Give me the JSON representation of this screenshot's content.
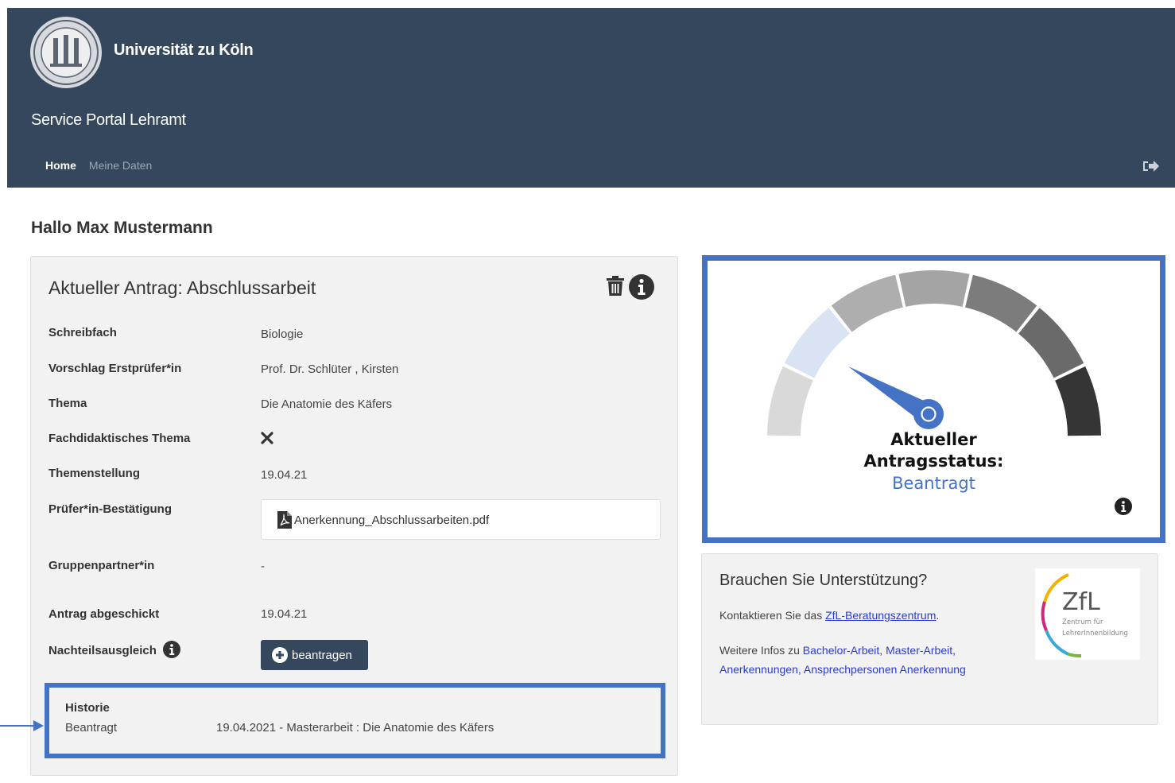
{
  "header": {
    "university": "Universität zu Köln",
    "portal": "Service Portal Lehramt",
    "nav": [
      {
        "label": "Home",
        "active": true
      },
      {
        "label": "Meine Daten",
        "active": false
      }
    ]
  },
  "greeting": "Hallo Max Mustermann",
  "application": {
    "title": "Aktueller Antrag: Abschlussarbeit",
    "rows": {
      "schreibfach": {
        "label": "Schreibfach",
        "value": "Biologie"
      },
      "erstpruefer": {
        "label": "Vorschlag Erstprüfer*in",
        "value": "Prof. Dr. Schlüter , Kirsten"
      },
      "thema": {
        "label": "Thema",
        "value": "Die Anatomie des Käfers"
      },
      "fachdidaktik": {
        "label": "Fachdidaktisches Thema"
      },
      "themenstellung": {
        "label": "Themenstellung",
        "value": "19.04.21"
      },
      "bestaetigung": {
        "label": "Prüfer*in-Bestätigung",
        "file": "Anerkennung_Abschlussarbeiten.pdf"
      },
      "gruppenpartner": {
        "label": "Gruppenpartner*in",
        "value": "-"
      },
      "abgeschickt": {
        "label": "Antrag abgeschickt",
        "value": "19.04.21"
      },
      "nachteilsausgleich": {
        "label": "Nachteilsausgleich",
        "button": "beantragen"
      }
    },
    "history": {
      "title": "Historie",
      "status": "Beantragt",
      "entry": "19.04.2021 - Masterarbeit : Die Anatomie des Käfers"
    }
  },
  "status": {
    "line1": "Aktueller",
    "line2": "Antragsstatus:",
    "value": "Beantragt",
    "gauge_segments": 7,
    "active_segment": 2,
    "colors": {
      "highlight": "#4472c4",
      "active_segment": "#d9e3f3",
      "header": "#34475c"
    }
  },
  "support": {
    "title": "Brauchen Sie Unterstützung?",
    "contact_prefix": "Kontaktieren Sie das ",
    "contact_link": "ZfL-Beratungszentrum",
    "contact_suffix": ".",
    "info_prefix": "Weitere Infos zu ",
    "links": [
      "Bachelor-Arbeit",
      "Master-Arbeit",
      "Anerkennungen",
      "Ansprechpersonen Anerkennung"
    ],
    "logo_text": "ZfL",
    "logo_sub1": "Zentrum für",
    "logo_sub2": "LehrerInnenbildung"
  }
}
